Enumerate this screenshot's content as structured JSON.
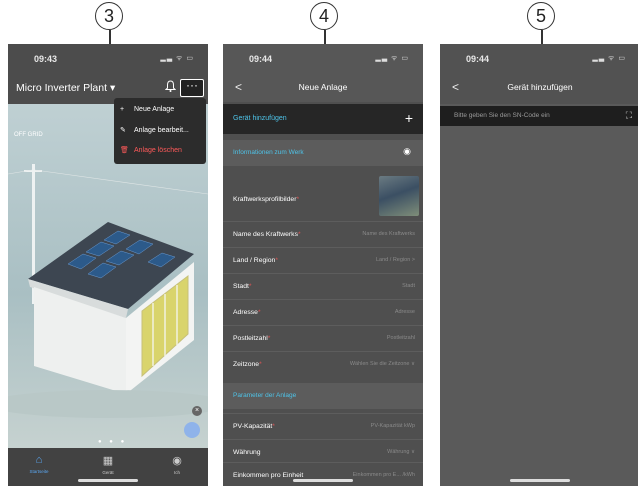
{
  "steps": [
    "3",
    "4",
    "5"
  ],
  "screen3": {
    "time": "09:43",
    "status_icons": "▂▃ ᯤ ▭",
    "plant_name": "Micro Inverter Plant ▾",
    "bell_icon": "bell-icon",
    "more_label": "···",
    "offgrid": "OFF GRID",
    "menu": [
      {
        "icon": "+",
        "label": "Neue Anlage"
      },
      {
        "icon": "✎",
        "label": "Anlage bearbeit..."
      },
      {
        "icon": "🗑",
        "label": "Anlage löschen"
      }
    ],
    "page_dots": "● ● ●",
    "close_fab": "×",
    "tabs": [
      {
        "icon": "⌂",
        "label": "Startseite"
      },
      {
        "icon": "▦",
        "label": "Gerät"
      },
      {
        "icon": "◉",
        "label": "Ich"
      }
    ]
  },
  "screen4": {
    "time": "09:44",
    "status_icons": "▂▃ ᯤ ▭",
    "back": "<",
    "title": "Neue Anlage",
    "add_device": "Gerät hinzufügen",
    "add_plus": "+",
    "section_work": "Informationen zum Werk",
    "section_work_icon": "◉",
    "fields": [
      {
        "label": "Kraftwerksprofilbilder",
        "value": ""
      },
      {
        "label": "Name des Kraftwerks",
        "value": "Name des Kraftwerks"
      },
      {
        "label": "Land / Region",
        "value": "Land / Region >"
      },
      {
        "label": "Stadt",
        "value": "Stadt"
      },
      {
        "label": "Adresse",
        "value": "Adresse"
      },
      {
        "label": "Postleitzahl",
        "value": "Postleitzahl"
      },
      {
        "label": "Zeitzone",
        "value": "Wählen Sie die Zeitzone ∨"
      }
    ],
    "section_params": "Parameter der Anlage",
    "params": [
      {
        "label": "PV-Kapazität",
        "value": "PV-Kapazität   kWp"
      },
      {
        "label": "Währung",
        "value": "Währung ∨"
      },
      {
        "label": "Einkommen pro Einheit",
        "value": "Einkommen pro E...   /kWh"
      }
    ]
  },
  "screen5": {
    "time": "09:44",
    "status_icons": "▂▃ ᯤ ▭",
    "back": "<",
    "title": "Gerät hinzufügen",
    "sn_placeholder": "Bitte geben Sie den SN-Code ein",
    "scan_icon": "⛶"
  }
}
